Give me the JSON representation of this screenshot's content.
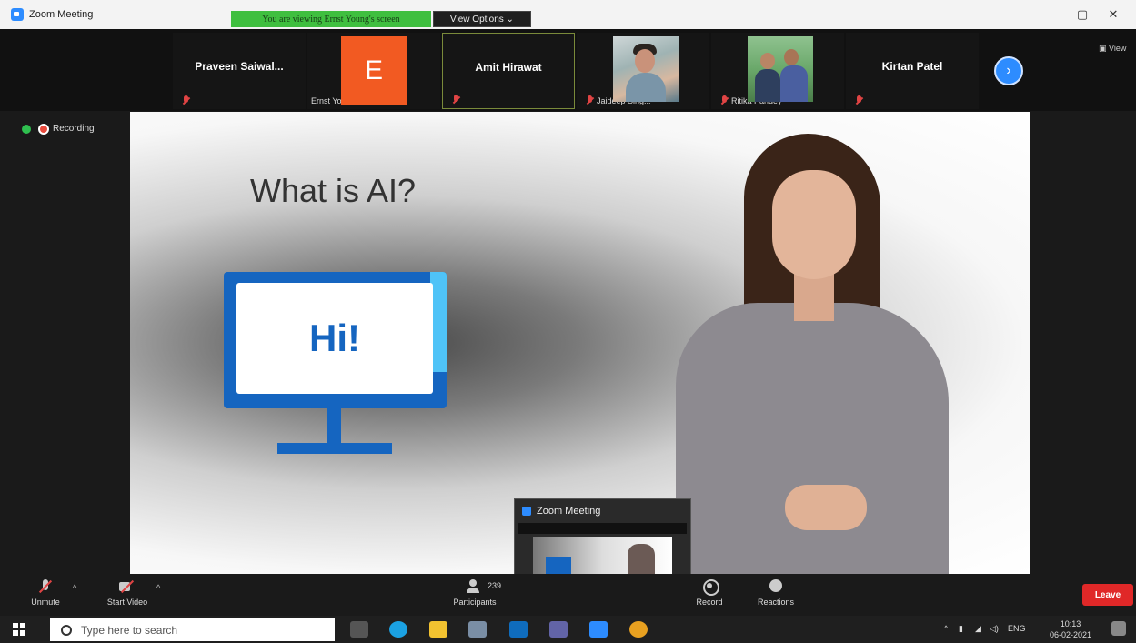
{
  "window": {
    "title": "Zoom Meeting",
    "viewing_banner": "You are viewing Ernst Young's screen",
    "view_options": "View Options",
    "view_label": "View",
    "controls": [
      "–",
      "▢",
      "✕"
    ]
  },
  "gallery": {
    "tiles": [
      {
        "name": "Praveen Saiwal..."
      },
      {
        "caption": "Ernst Young",
        "avatar_letter": "E"
      },
      {
        "name": "Amit Hirawat"
      },
      {
        "caption": "Jaideep Sing..."
      },
      {
        "caption": "Ritika Pandey"
      },
      {
        "name": "Kirtan Patel"
      }
    ],
    "next_icon": "chevron-right-icon"
  },
  "status": {
    "recording": "Recording"
  },
  "slide": {
    "title": "What is AI?",
    "monitor_text": "Hi!"
  },
  "mini_window": {
    "title": "Zoom Meeting"
  },
  "toolbar": {
    "unmute": "Unmute",
    "start_video": "Start Video",
    "participants": "Participants",
    "participant_count": "239",
    "record": "Record",
    "reactions": "Reactions",
    "leave": "Leave"
  },
  "taskbar": {
    "search_placeholder": "Type here to search",
    "language": "ENG",
    "time": "10:13",
    "date": "06-02-2021"
  },
  "colors": {
    "accent": "#2d8cff",
    "banner": "#3fbf3f",
    "leave": "#e02828",
    "avatar": "#f25a22"
  }
}
